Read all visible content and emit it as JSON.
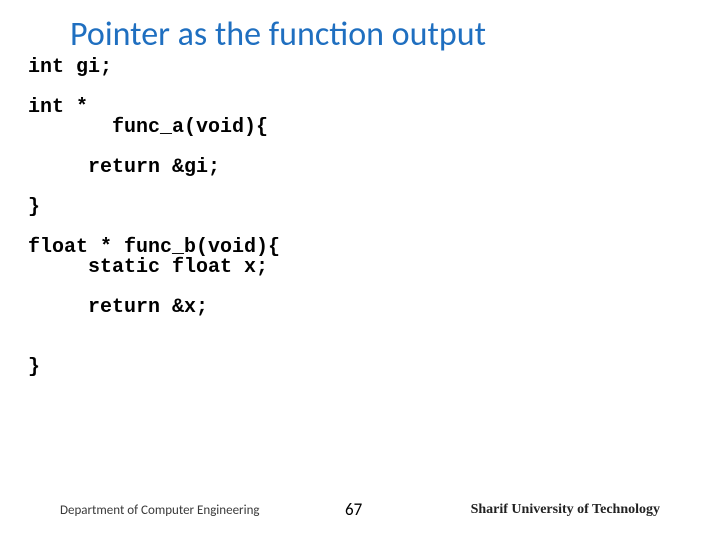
{
  "title": "Pointer as the function output",
  "code": "int gi;\n\nint *\n       func_a(void){\n\n     return &gi;\n\n}\n\nfloat * func_b(void){\n     static float x;\n\n     return &x;\n\n\n}",
  "footer": {
    "left": "Department of Computer Engineering",
    "page": "67",
    "right": "Sharif University of Technology"
  }
}
